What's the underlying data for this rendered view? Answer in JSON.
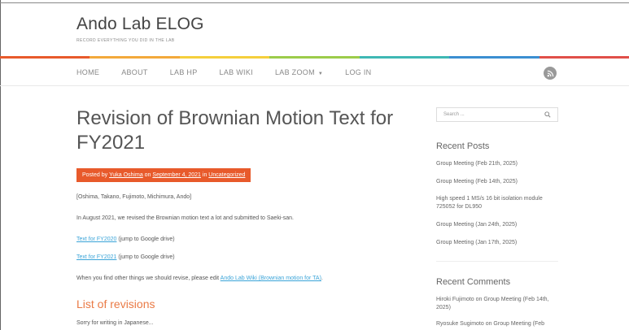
{
  "site": {
    "title": "Ando Lab ELOG",
    "tagline": "RECORD EVERYTHING YOU DID IN THE LAB"
  },
  "stripe_colors": [
    "#e85a2b",
    "#f3a93b",
    "#f5cf3c",
    "#9ccc4a",
    "#3fb8b4",
    "#3b8fd1",
    "#e04f49"
  ],
  "nav": {
    "items": [
      "HOME",
      "ABOUT",
      "LAB HP",
      "LAB WIKI",
      "LAB ZOOM",
      "LOG IN"
    ],
    "rss_icon": "rss-icon"
  },
  "post": {
    "title": "Revision of Brownian Motion Text for FY2021",
    "meta": {
      "prefix": "Posted by ",
      "author": "Yuka Oshima",
      "on": " on ",
      "date": "September 4, 2021",
      "in": " in ",
      "category": "Uncategorized"
    },
    "authors_line": "[Oshima, Takano, Fujimoto, Michimura, Ando]",
    "intro": "In August 2021, we revised the Brownian motion text a lot and submitted to Saeki-san.",
    "link1": {
      "text": "Text for FY2020",
      "note": " (jump to Google drive)"
    },
    "link2": {
      "text": "Text for FY2021",
      "note": " (jump to Google drive)"
    },
    "revise": {
      "prefix": "When you find other things we should revise, please edit ",
      "link": "Ando Lab Wiki (Brownian motion for TA)",
      "suffix": "."
    },
    "subheading": "List of revisions",
    "sorry": "Sorry for writing in Japanese..."
  },
  "sidebar": {
    "search_placeholder": "Search ...",
    "recent_posts_title": "Recent Posts",
    "recent_posts": [
      "Group Meeting (Feb 21th, 2025)",
      "Group Meeting (Feb 14th, 2025)",
      "High speed 1 MS/s 16 bit isolation module 725052 for DL950",
      "Group Meeting (Jan 24th, 2025)",
      "Group Meeting (Jan 17th, 2025)"
    ],
    "recent_comments_title": "Recent Comments",
    "recent_comments": [
      "Hiroki Fujimoto on Group Meeting (Feb 14th, 2025)",
      "Ryosuke Sugimoto on Group Meeting (Feb"
    ]
  }
}
